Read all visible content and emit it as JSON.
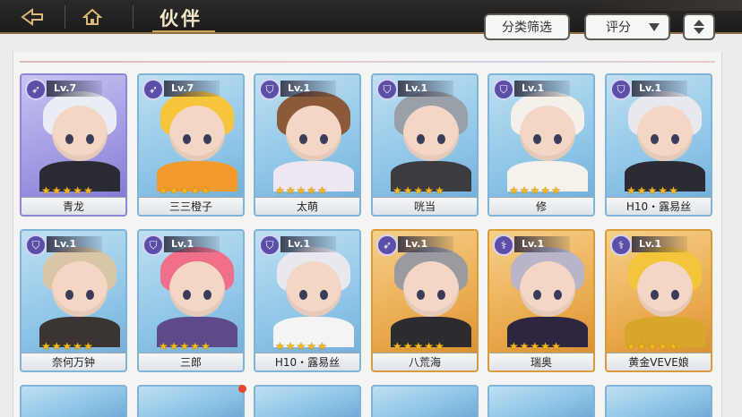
{
  "header": {
    "title": "伙伴",
    "back_icon": "back-arrow-icon",
    "home_icon": "home-icon"
  },
  "controls": {
    "filter_label": "分类筛选",
    "sort_label": "评分",
    "order_icon": "sort-order-icon"
  },
  "cards": [
    {
      "name": "青龙",
      "level": "Lv.7",
      "stars": 5,
      "frame": "purple",
      "class_icon": "bow-icon",
      "hair": "#e9eef4",
      "body": "#2a2a35"
    },
    {
      "name": "三三橙子",
      "level": "Lv.7",
      "stars": 5,
      "frame": "blue",
      "class_icon": "bow-icon",
      "hair": "#f5c53b",
      "body": "#f29a2e"
    },
    {
      "name": "太萌",
      "level": "Lv.1",
      "stars": 5,
      "frame": "blue",
      "class_icon": "shield-icon",
      "hair": "#8b5a3b",
      "body": "#efe7f2"
    },
    {
      "name": "咣当",
      "level": "Lv.1",
      "stars": 5,
      "frame": "blue",
      "class_icon": "shield-icon",
      "hair": "#9aa0a8",
      "body": "#3b3b40"
    },
    {
      "name": "修",
      "level": "Lv.1",
      "stars": 5,
      "frame": "blue",
      "class_icon": "shield-icon",
      "hair": "#f5f1ea",
      "body": "#f6f1ea"
    },
    {
      "name": "H10・露易丝",
      "level": "Lv.1",
      "stars": 5,
      "frame": "blue",
      "class_icon": "shield-icon",
      "hair": "#e7e9ee",
      "body": "#2b2b33"
    },
    {
      "name": "奈何万钟",
      "level": "Lv.1",
      "stars": 5,
      "frame": "blue",
      "class_icon": "shield-icon",
      "hair": "#d9c6a6",
      "body": "#3a3530"
    },
    {
      "name": "三郎",
      "level": "Lv.1",
      "stars": 5,
      "frame": "blue",
      "class_icon": "shield-icon",
      "hair": "#f06f8a",
      "body": "#5c4a8a"
    },
    {
      "name": "H10・露易丝",
      "level": "Lv.1",
      "stars": 5,
      "frame": "blue",
      "class_icon": "shield-icon",
      "hair": "#e7e9ee",
      "body": "#f4f4f4"
    },
    {
      "name": "八荒海",
      "level": "Lv.1",
      "stars": 5,
      "frame": "gold",
      "class_icon": "bow-icon",
      "hair": "#9a9aa0",
      "body": "#2c2c30"
    },
    {
      "name": "瑞奥",
      "level": "Lv.1",
      "stars": 5,
      "frame": "gold",
      "class_icon": "staff-icon",
      "hair": "#b9b4c8",
      "body": "#2e2540"
    },
    {
      "name": "黄金VEVE娘",
      "level": "Lv.1",
      "stars": 5,
      "frame": "gold",
      "class_icon": "staff-icon",
      "hair": "#f3c53a",
      "body": "#d7a62a"
    }
  ]
}
